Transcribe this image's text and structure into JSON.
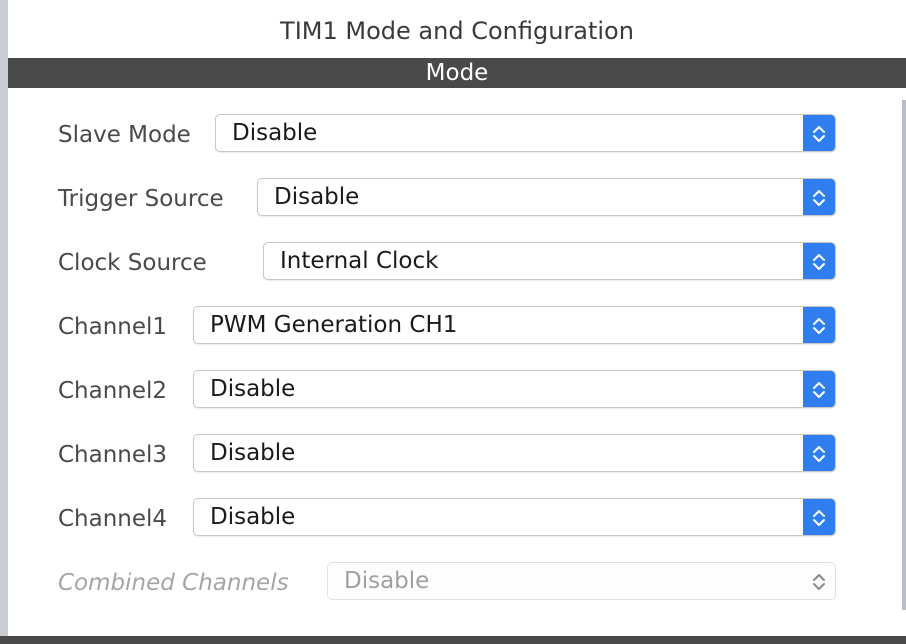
{
  "window": {
    "title": "TIM1 Mode and Configuration"
  },
  "section": {
    "title": "Mode"
  },
  "fields": [
    {
      "label": "Slave Mode",
      "value": "Disable",
      "enabled": true
    },
    {
      "label": "Trigger Source",
      "value": "Disable",
      "enabled": true
    },
    {
      "label": "Clock Source",
      "value": "Internal Clock",
      "enabled": true
    },
    {
      "label": "Channel1",
      "value": "PWM Generation CH1",
      "enabled": true
    },
    {
      "label": "Channel2",
      "value": "Disable",
      "enabled": true
    },
    {
      "label": "Channel3",
      "value": "Disable",
      "enabled": true
    },
    {
      "label": "Channel4",
      "value": "Disable",
      "enabled": true
    },
    {
      "label": "Combined Channels",
      "value": "Disable",
      "enabled": false
    }
  ],
  "colors": {
    "accent": "#2f7ef0",
    "header_bar": "#4a4a4a",
    "label": "#4a4a4a",
    "disabled_text": "#a5a5a5"
  },
  "icons": {
    "select_stepper": "chevron-up-down-icon"
  }
}
